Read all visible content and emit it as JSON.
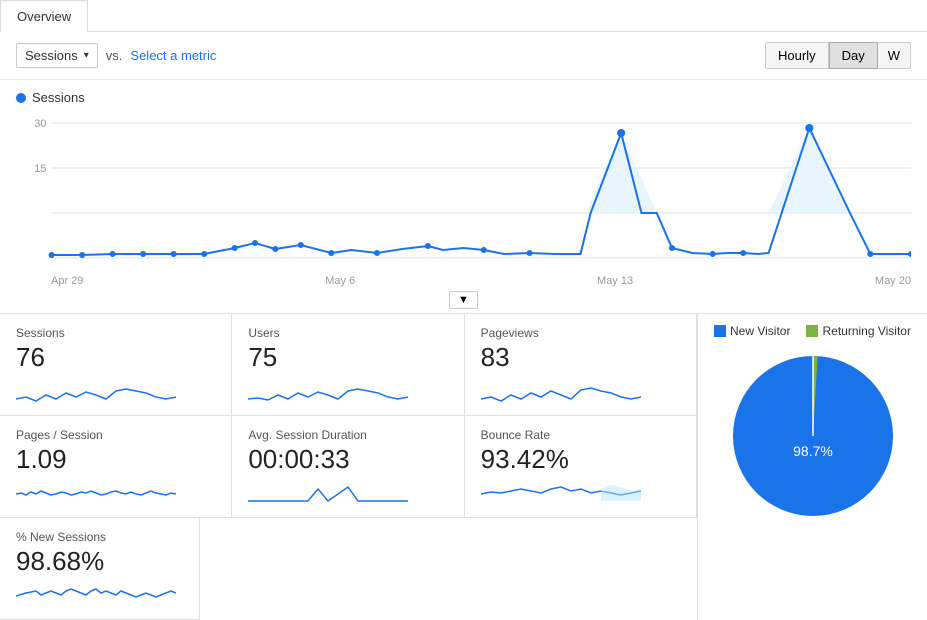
{
  "tab": {
    "label": "Overview"
  },
  "controls": {
    "sessions_label": "Sessions",
    "vs_label": "vs.",
    "select_metric_label": "Select a metric",
    "period_buttons": [
      "Hourly",
      "Day",
      "W"
    ],
    "active_period": "Day"
  },
  "chart": {
    "legend_label": "Sessions",
    "y_labels": [
      "30",
      "15"
    ],
    "x_labels": [
      "Apr 29",
      "May 6",
      "May 13",
      "May 20"
    ],
    "scroll_btn": "▼"
  },
  "stats": [
    {
      "label": "Sessions",
      "value": "76"
    },
    {
      "label": "Users",
      "value": "75"
    },
    {
      "label": "Pageviews",
      "value": "83"
    },
    {
      "label": "Pages / Session",
      "value": "1.09"
    },
    {
      "label": "Avg. Session Duration",
      "value": "00:00:33"
    },
    {
      "label": "Bounce Rate",
      "value": "93.42%"
    },
    {
      "label": "% New Sessions",
      "value": "98.68%"
    }
  ],
  "pie_chart": {
    "legend": [
      {
        "label": "New Visitor",
        "color": "#1a73e8"
      },
      {
        "label": "Returning Visitor",
        "color": "#7cb342"
      }
    ],
    "new_pct": 98.7,
    "returning_pct": 1.3,
    "center_label": "98.7%"
  }
}
